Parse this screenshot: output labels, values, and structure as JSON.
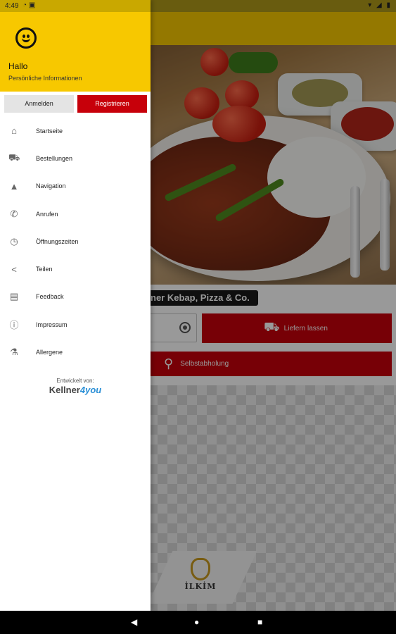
{
  "status_bar": {
    "time": "4:49",
    "left_icons": "◔ ▣",
    "right_icons": "▾ ◢ ▮"
  },
  "drawer": {
    "header": {
      "greeting": "Hallo",
      "subtitle": "Persönliche Informationen",
      "avatar_icon": "smiley-icon"
    },
    "login_label": "Anmelden",
    "register_label": "Registrieren",
    "menu": [
      {
        "label": "Startseite",
        "icon": "home-icon",
        "glyph": "⌂"
      },
      {
        "label": "Bestellungen",
        "icon": "basket-icon",
        "glyph": "⛟"
      },
      {
        "label": "Navigation",
        "icon": "navigation-arrow-icon",
        "glyph": "▲"
      },
      {
        "label": "Anrufen",
        "icon": "phone-icon",
        "glyph": "✆"
      },
      {
        "label": "Öffnungszeiten",
        "icon": "clock-icon",
        "glyph": "◷"
      },
      {
        "label": "Teilen",
        "icon": "share-icon",
        "glyph": "<"
      },
      {
        "label": "Feedback",
        "icon": "feedback-icon",
        "glyph": "▤"
      },
      {
        "label": "Impressum",
        "icon": "info-icon",
        "glyph": "ⓘ"
      },
      {
        "label": "Allergene",
        "icon": "allergens-icon",
        "glyph": "⚗"
      }
    ],
    "developer": {
      "label": "Entwickelt von:",
      "brand_main": "Kellner",
      "brand_accent": "4you"
    }
  },
  "main": {
    "restaurant_title": "ner Kebap,  Pizza & Co.",
    "deliver_label": "Liefern lassen",
    "pickup_label": "Selbstabholung",
    "logo_text": "İLKİM"
  },
  "colors": {
    "primary_yellow": "#f7c800",
    "accent_red": "#c7000a"
  }
}
